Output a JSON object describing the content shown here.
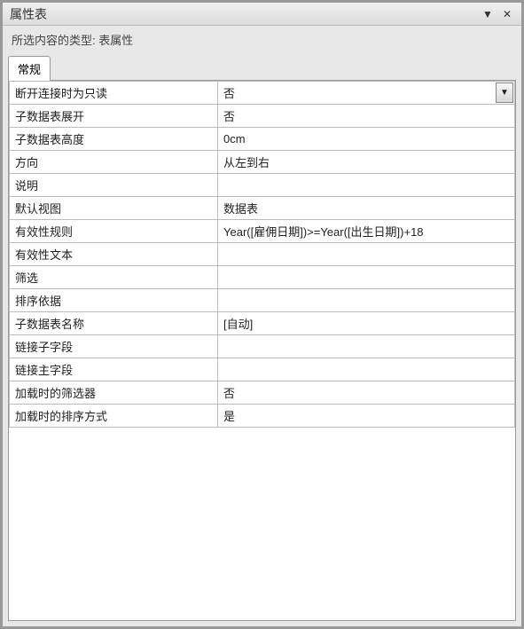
{
  "panel": {
    "title": "属性表",
    "subtitle_prefix": "所选内容的类型:",
    "subtitle_value": "表属性"
  },
  "tabs": [
    {
      "label": "常规"
    }
  ],
  "properties": [
    {
      "label": "断开连接时为只读",
      "value": "否",
      "dropdown": true
    },
    {
      "label": "子数据表展开",
      "value": "否"
    },
    {
      "label": "子数据表高度",
      "value": "0cm"
    },
    {
      "label": "方向",
      "value": "从左到右"
    },
    {
      "label": "说明",
      "value": ""
    },
    {
      "label": "默认视图",
      "value": "数据表"
    },
    {
      "label": "有效性规则",
      "value": "Year([雇佣日期])>=Year([出生日期])+18"
    },
    {
      "label": "有效性文本",
      "value": ""
    },
    {
      "label": "筛选",
      "value": ""
    },
    {
      "label": "排序依据",
      "value": ""
    },
    {
      "label": "子数据表名称",
      "value": "[自动]"
    },
    {
      "label": "链接子字段",
      "value": ""
    },
    {
      "label": "链接主字段",
      "value": ""
    },
    {
      "label": "加载时的筛选器",
      "value": "否"
    },
    {
      "label": "加载时的排序方式",
      "value": "是"
    }
  ],
  "icons": {
    "minimize": "▼",
    "close": "✕",
    "dropdown": "▼"
  }
}
